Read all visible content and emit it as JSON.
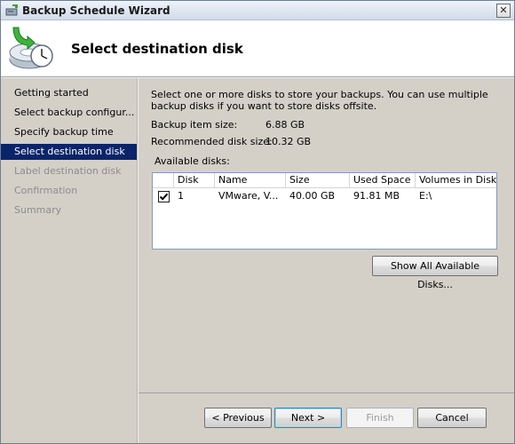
{
  "window": {
    "title": "Backup Schedule Wizard",
    "close_glyph": "✕"
  },
  "header": {
    "title": "Select destination disk",
    "icon": "backup-clock-icon"
  },
  "sidebar": {
    "steps": [
      {
        "label": "Getting started",
        "state": "normal"
      },
      {
        "label": "Select backup configur...",
        "state": "normal"
      },
      {
        "label": "Specify backup time",
        "state": "normal"
      },
      {
        "label": "Select destination disk",
        "state": "active"
      },
      {
        "label": "Label destination disk",
        "state": "disabled"
      },
      {
        "label": "Confirmation",
        "state": "disabled"
      },
      {
        "label": "Summary",
        "state": "disabled"
      }
    ]
  },
  "content": {
    "description": "Select one or more disks to store your backups. You can use multiple backup disks if you want to store disks offsite.",
    "backup_item_size": {
      "label": "Backup item size:",
      "value": "6.88 GB"
    },
    "recommended_disk_size": {
      "label": "Recommended disk size:",
      "value": "10.32 GB"
    },
    "available_disks_label": "Available disks:",
    "table": {
      "columns": [
        "Disk",
        "Name",
        "Size",
        "Used Space",
        "Volumes in Disk"
      ],
      "rows": [
        {
          "checked": true,
          "disk": "1",
          "name": "VMware, V...",
          "size": "40.00 GB",
          "used_space": "91.81 MB",
          "volumes": "E:\\"
        }
      ]
    },
    "show_all_button": "Show All Available Disks..."
  },
  "buttons": {
    "previous": "< Previous",
    "next": "Next >",
    "finish": "Finish",
    "cancel": "Cancel"
  },
  "colors": {
    "active_step_bg": "#0a246a",
    "panel_bg": "#d4d0c8"
  }
}
